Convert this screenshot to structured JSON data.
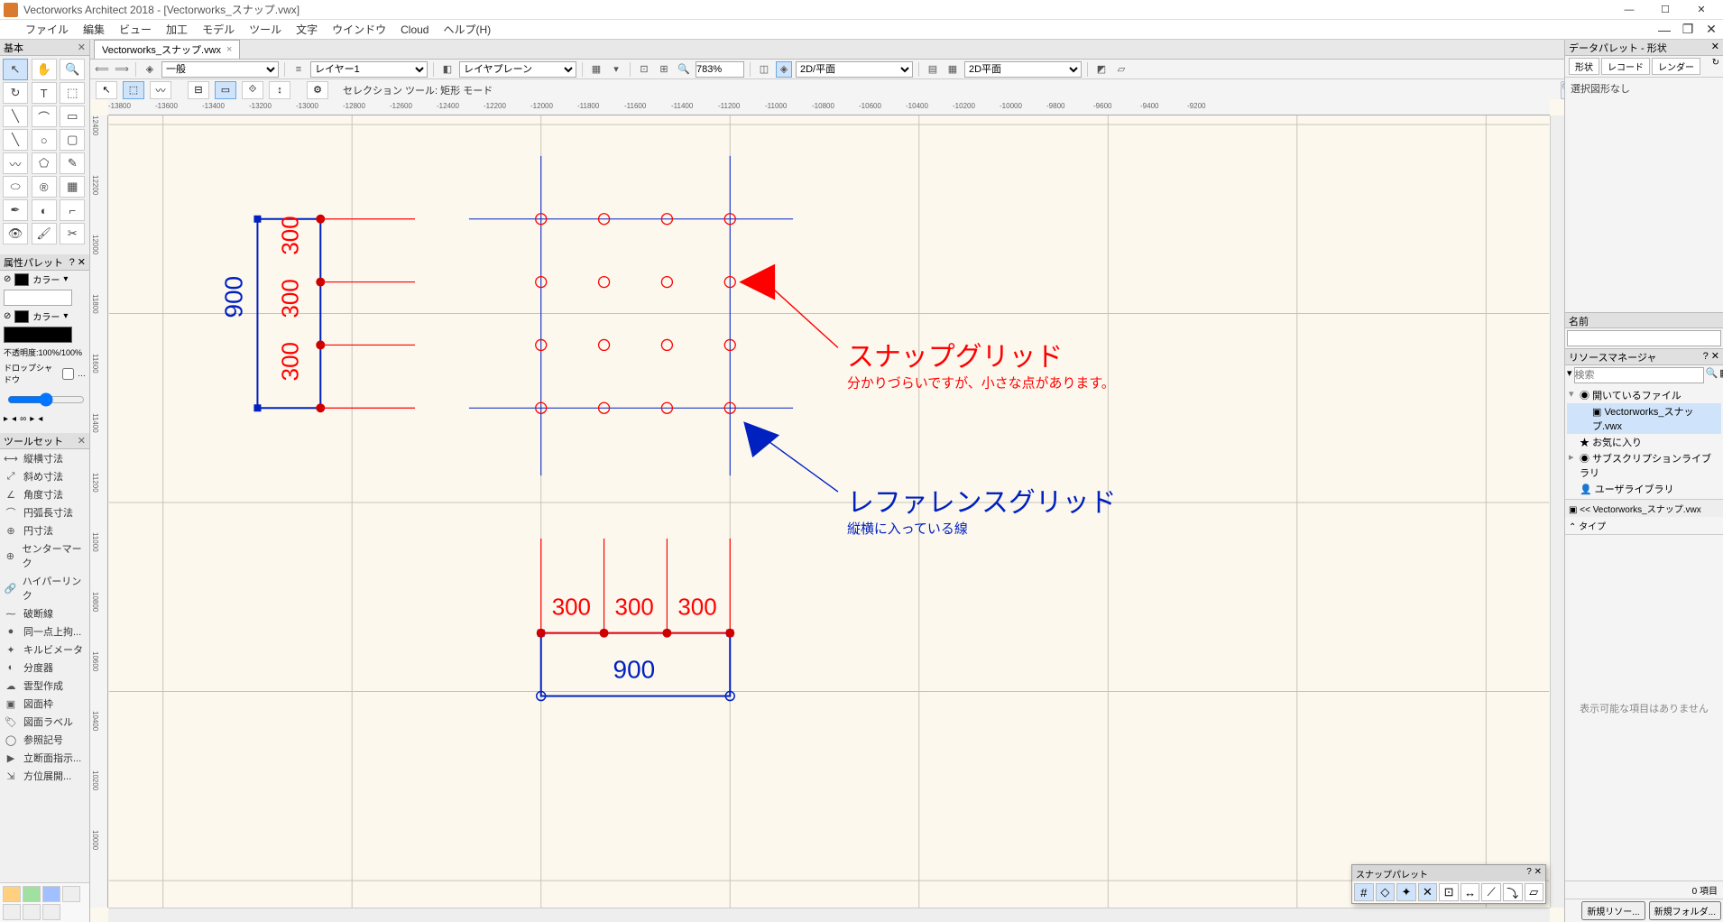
{
  "app": {
    "title": "Vectorworks Architect 2018 - [Vectorworks_スナップ.vwx]",
    "filename": "Vectorworks_スナップ.vwx"
  },
  "menu": [
    "ファイル",
    "編集",
    "ビュー",
    "加工",
    "モデル",
    "ツール",
    "文字",
    "ウインドウ",
    "Cloud",
    "ヘルプ(H)"
  ],
  "viewbar": {
    "class_sel": "一般",
    "layer_sel": "レイヤー1",
    "plane_sel": "レイヤプレーン",
    "zoom": "783%",
    "view_sel": "2D/平面",
    "render_sel": "2D平面"
  },
  "modebar": {
    "label": "セレクション ツール: 矩形 モード"
  },
  "palettes": {
    "basic_title": "基本",
    "attr_title": "属性パレット",
    "color_label": "カラー",
    "opacity": "不透明度:100%/100%",
    "dropshadow": "ドロップシャドウ",
    "slider_val": "0.05",
    "toolset_title": "ツールセット",
    "toolset_items": [
      "縦横寸法",
      "斜め寸法",
      "角度寸法",
      "円弧長寸法",
      "円寸法",
      "センターマーク",
      "ハイパーリンク",
      "破断線",
      "同一点上拘...",
      "キルビメータ",
      "分度器",
      "雲型作成",
      "図面枠",
      "図面ラベル",
      "参照記号",
      "立断面指示...",
      "方位展開..."
    ]
  },
  "right": {
    "data_title": "データパレット - 形状",
    "data_tabs": [
      "形状",
      "レコード",
      "レンダー"
    ],
    "data_msg": "選択図形なし",
    "name_label": "名前",
    "rmgr_title": "リソースマネージャ",
    "search_ph": "検索",
    "tree": {
      "open_files": "開いているファイル",
      "current": "Vectorworks_スナップ.vwx",
      "fav": "お気に入り",
      "sub": "サブスクリプションライブラリ",
      "user": "ユーザライブラリ",
      "crumb": "<< Vectorworks_スナップ.vwx",
      "type_label": "タイプ"
    },
    "empty_msg": "表示可能な項目はありません",
    "item_count": "0 項目",
    "btn_new_res": "新規リソー...",
    "btn_new_fld": "新規フォルダ..."
  },
  "snap_palette": {
    "title": "スナップパレット"
  },
  "drawing": {
    "dim_300": "300",
    "dim_900": "900",
    "anno_snap_title": "スナップグリッド",
    "anno_snap_sub": "分かりづらいですが、小さな点があります。",
    "anno_ref_title": "レファレンスグリッド",
    "anno_ref_sub": "縦横に入っている線"
  },
  "ruler_h": [
    "-13800",
    "-13600",
    "-13400",
    "-13200",
    "-13000",
    "-12800",
    "-12600",
    "-12400",
    "-12200",
    "-12000",
    "-11800",
    "-11600",
    "-11400",
    "-11200",
    "-11000",
    "-10800",
    "-10600",
    "-10400",
    "-10200",
    "-10000",
    "-9800",
    "-9600",
    "-9400",
    "-9200"
  ],
  "ruler_v": [
    "12400",
    "12200",
    "12000",
    "11800",
    "11600",
    "11400",
    "11200",
    "11000",
    "10800",
    "10600",
    "10400",
    "10200",
    "10000"
  ]
}
